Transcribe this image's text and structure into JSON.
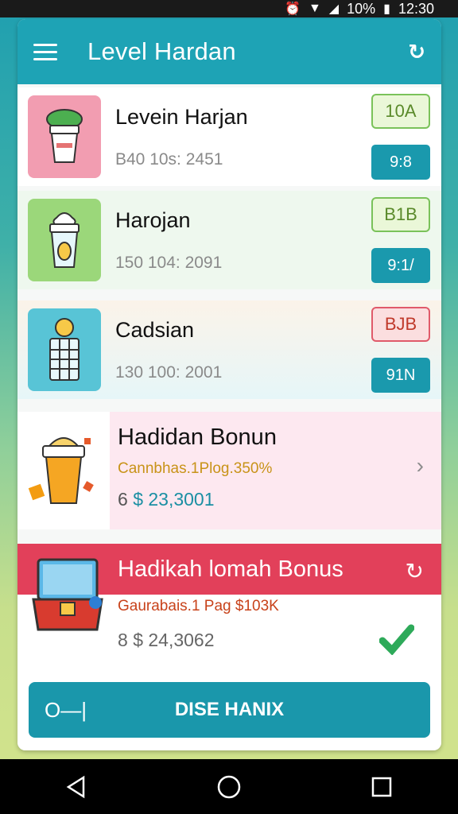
{
  "status_bar": {
    "battery": "10%",
    "time": "12:30"
  },
  "app_bar": {
    "title": "Level Hardan"
  },
  "levels": [
    {
      "name": "Levein Harjan",
      "meta": "B40 10s: 2451",
      "badge_top": "10A",
      "badge_bottom": "9:8",
      "bg": "#ffffff",
      "badge_color": "#7ac25a",
      "badge_fill": "#eaf7d8",
      "thumb": "#f29db1"
    },
    {
      "name": "Harojan",
      "meta": "150 104: 2091",
      "badge_top": "B1B",
      "badge_bottom": "9:1/",
      "bg": "#eef8ee",
      "badge_color": "#7ac25a",
      "badge_fill": "#eaf7d8",
      "thumb": "#9bd77a"
    },
    {
      "name": "Cadsian",
      "meta": "130 100: 2001",
      "badge_top": "BJB",
      "badge_bottom": "91N",
      "bg": "#fbf3e9",
      "badge_color": "#e05a6a",
      "badge_fill": "#fbdedf",
      "thumb": "#58c4d6"
    }
  ],
  "bonus": {
    "title": "Hadidan Bonun",
    "subtitle": "Cannbhas.1Plog.350%",
    "amount": "$ 23,3001",
    "amount_prefix": "6"
  },
  "big_bonus": {
    "title": "Hadikah lomah Bonus",
    "subtitle": "Gaurabais.1 Pag $103K",
    "amount": "$ 24,3062",
    "amount_prefix": "8"
  },
  "action": {
    "label": "DISE HANIX",
    "icon_text": "O—|"
  },
  "colors": {
    "primary": "#1ea3b5",
    "accent_red": "#e2405a",
    "bonus_pink": "#fde8f0",
    "gold": "#c89318"
  }
}
